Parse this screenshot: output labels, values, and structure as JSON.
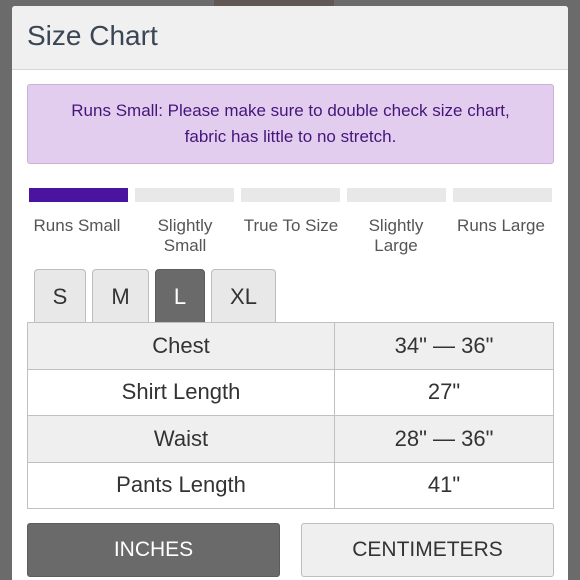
{
  "modal": {
    "title": "Size Chart"
  },
  "notice": {
    "line1": "Runs Small: Please make sure to double check size chart,",
    "line2": "fabric has little to no stretch."
  },
  "fit_scale": {
    "selected_index": 0,
    "labels": [
      {
        "line1": "Runs Small",
        "line2": ""
      },
      {
        "line1": "Slightly",
        "line2": "Small"
      },
      {
        "line1": "True To Size",
        "line2": ""
      },
      {
        "line1": "Slightly",
        "line2": "Large"
      },
      {
        "line1": "Runs Large",
        "line2": ""
      }
    ],
    "active_color": "#4a13a0",
    "inactive_color": "#e8e8e8"
  },
  "sizes": {
    "options": [
      "S",
      "M",
      "L",
      "XL"
    ],
    "selected": "L"
  },
  "measurements": [
    {
      "label": "Chest",
      "value": "34\" — 36\""
    },
    {
      "label": "Shirt Length",
      "value": "27\""
    },
    {
      "label": "Waist",
      "value": "28\" — 36\""
    },
    {
      "label": "Pants Length",
      "value": "41\""
    }
  ],
  "units": {
    "inches_label": "INCHES",
    "centimeters_label": "CENTIMETERS",
    "selected": "INCHES"
  }
}
